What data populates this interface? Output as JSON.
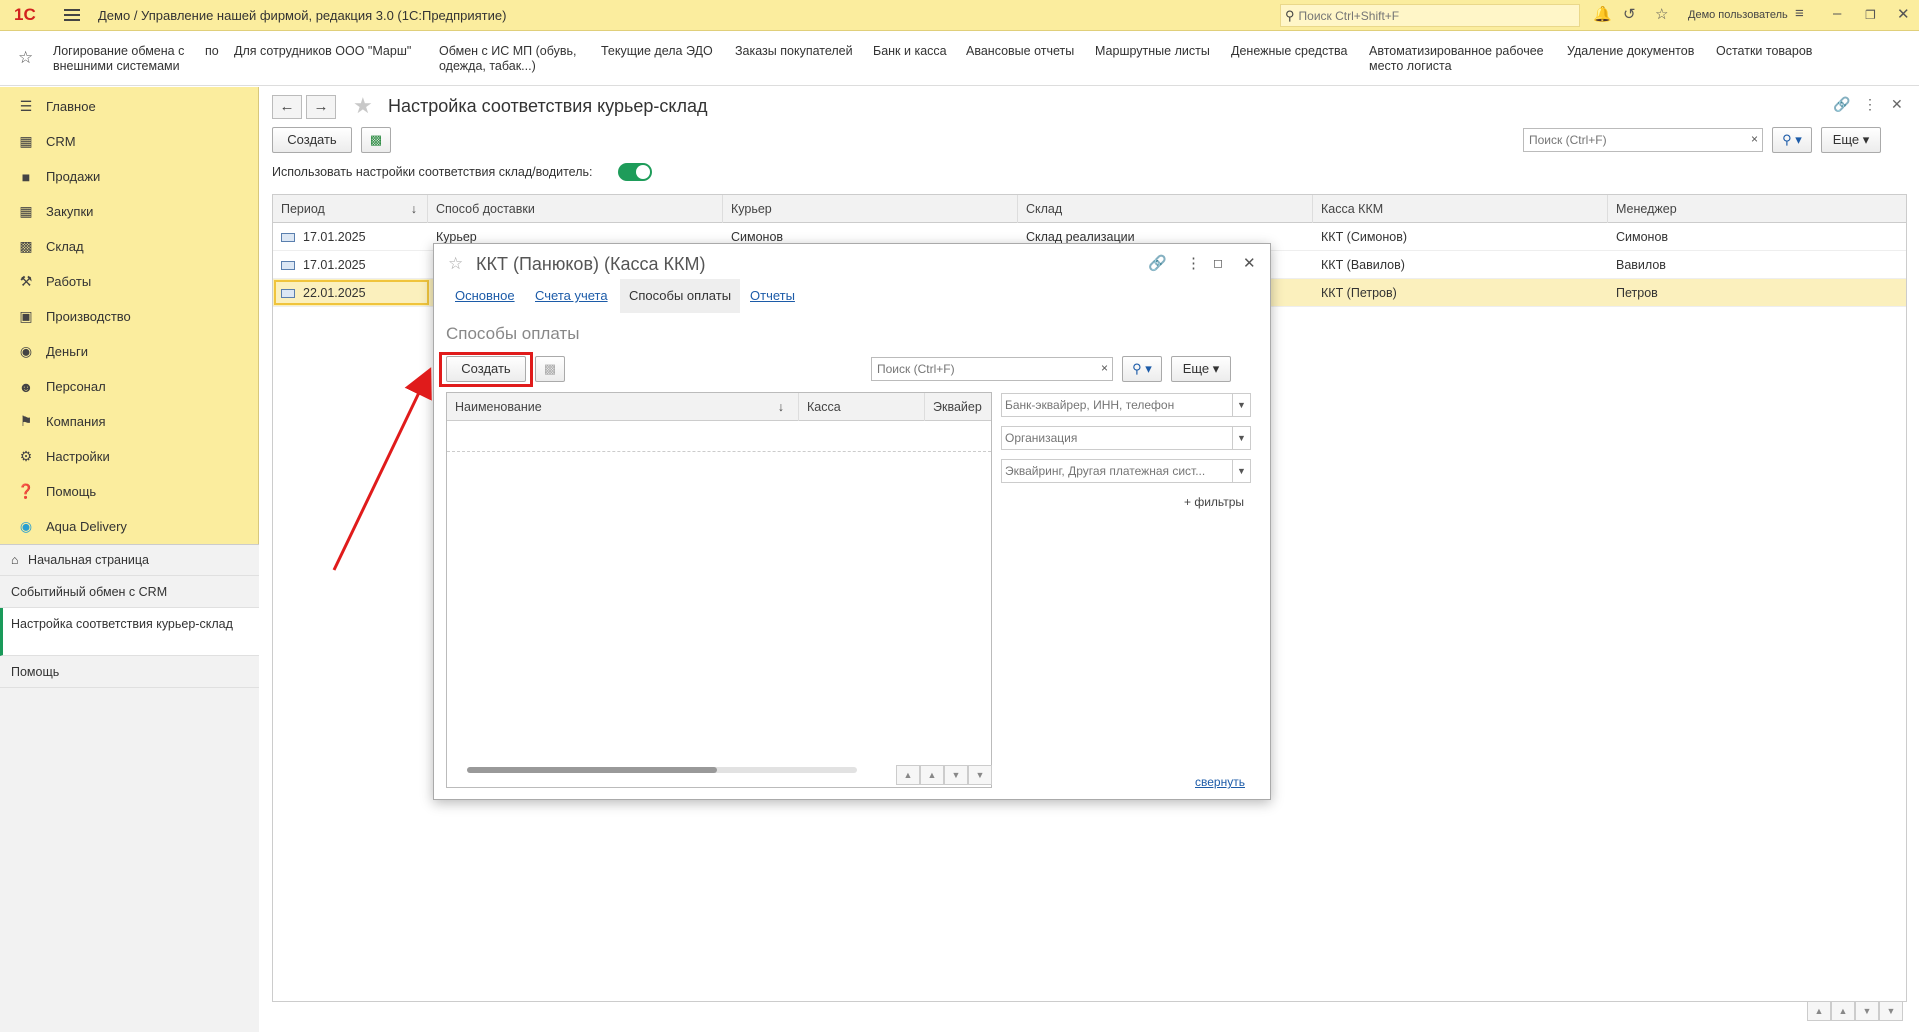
{
  "titlebar": {
    "logo": "1С",
    "title": "Демо / Управление нашей фирмой, редакция 3.0  (1С:Предприятие)",
    "search_placeholder": "Поиск Ctrl+Shift+F",
    "user": "Демо пользователь"
  },
  "favorites": [
    {
      "line1": "Логирование обмена с",
      "line2": "внешними системами"
    },
    {
      "line1": "по",
      "line2": ""
    },
    {
      "line1": "Для сотрудников ООО \"Марш\"",
      "line2": ""
    },
    {
      "line1": "Обмен с ИС МП (обувь,",
      "line2": "одежда, табак...)"
    },
    {
      "line1": "Текущие дела ЭДО",
      "line2": ""
    },
    {
      "line1": "Заказы покупателей",
      "line2": ""
    },
    {
      "line1": "Банк и касса",
      "line2": ""
    },
    {
      "line1": "Авансовые отчеты",
      "line2": ""
    },
    {
      "line1": "Маршрутные листы",
      "line2": ""
    },
    {
      "line1": "Денежные средства",
      "line2": ""
    },
    {
      "line1": "Автоматизированное рабочее",
      "line2": "место логиста"
    },
    {
      "line1": "Удаление документов",
      "line2": ""
    },
    {
      "line1": "Остатки товаров",
      "line2": ""
    }
  ],
  "sidebar": {
    "sections": [
      {
        "label": "Главное",
        "icon": "list-icon"
      },
      {
        "label": "CRM",
        "icon": "crm-icon"
      },
      {
        "label": "Продажи",
        "icon": "basket-icon"
      },
      {
        "label": "Закупки",
        "icon": "purchase-icon"
      },
      {
        "label": "Склад",
        "icon": "warehouse-icon"
      },
      {
        "label": "Работы",
        "icon": "tools-icon"
      },
      {
        "label": "Производство",
        "icon": "factory-icon"
      },
      {
        "label": "Деньги",
        "icon": "money-icon"
      },
      {
        "label": "Персонал",
        "icon": "people-icon"
      },
      {
        "label": "Компания",
        "icon": "flag-icon"
      },
      {
        "label": "Настройки",
        "icon": "gear-icon"
      },
      {
        "label": "Помощь",
        "icon": "help-icon"
      },
      {
        "label": "Aqua Delivery",
        "icon": "location-icon"
      }
    ],
    "open_windows": [
      {
        "label": "Начальная страница"
      },
      {
        "label": "Событийный обмен с CRM"
      },
      {
        "label": "Настройка соответствия курьер-склад"
      },
      {
        "label": "Помощь"
      }
    ]
  },
  "main": {
    "title": "Настройка соответствия курьер-склад",
    "create_label": "Создать",
    "search_placeholder": "Поиск (Ctrl+F)",
    "more_label": "Еще",
    "toggle_label": "Использовать настройки соответствия склад/водитель:",
    "toggle_on": true,
    "columns": [
      "Период",
      "Способ доставки",
      "Курьер",
      "Склад",
      "Касса ККМ",
      "Менеджер"
    ],
    "rows": [
      {
        "period": "17.01.2025",
        "delivery": "Курьер",
        "courier": "Симонов",
        "warehouse": "Склад реализации",
        "kkm": "ККТ (Симонов)",
        "manager": "Симонов"
      },
      {
        "period": "17.01.2025",
        "delivery": "",
        "courier": "",
        "warehouse": "",
        "kkm": "ККТ (Вавилов)",
        "manager": "Вавилов"
      },
      {
        "period": "22.01.2025",
        "delivery": "",
        "courier": "",
        "warehouse": "",
        "kkm": "ККТ (Петров)",
        "manager": "Петров"
      }
    ]
  },
  "dialog": {
    "title": "ККТ (Панюков) (Касса ККМ)",
    "tabs": [
      "Основное",
      "Счета учета",
      "Способы оплаты",
      "Отчеты"
    ],
    "active_tab": "Способы оплаты",
    "section_title": "Способы оплаты",
    "create_label": "Создать",
    "search_placeholder": "Поиск (Ctrl+F)",
    "more_label": "Еще",
    "columns": [
      "Наименование",
      "Касса",
      "Эквайер"
    ],
    "filters": [
      {
        "placeholder": "Банк-эквайрер, ИНН, телефон"
      },
      {
        "placeholder": "Организация"
      },
      {
        "placeholder": "Эквайринг, Другая платежная сист..."
      }
    ],
    "add_filters": "+ фильтры",
    "collapse": "свернуть"
  },
  "colors": {
    "sidebar_bg": "#fbed9e",
    "accent_green": "#1e9c5a",
    "highlight_red": "#e01b1b",
    "link_blue": "#1c5ba8",
    "selected_row": "#fbf0bd"
  }
}
